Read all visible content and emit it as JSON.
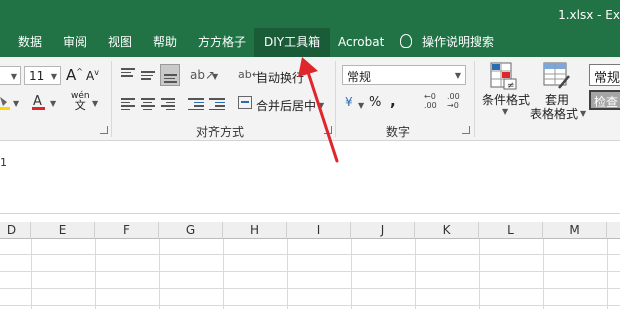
{
  "window": {
    "title": "1.xlsx  -  Ex"
  },
  "tabs": [
    {
      "label": "数据"
    },
    {
      "label": "审阅"
    },
    {
      "label": "视图"
    },
    {
      "label": "帮助"
    },
    {
      "label": "方方格子"
    },
    {
      "label": "DIY工具箱"
    },
    {
      "label": "Acrobat"
    }
  ],
  "active_tab": "DIY工具箱",
  "tell_me": {
    "label": "操作说明搜索"
  },
  "font": {
    "size": "11"
  },
  "alignment": {
    "wrap_text": "自动换行",
    "merge_center": "合并后居中",
    "group_label": "对齐方式"
  },
  "number": {
    "format": "常规",
    "currency_symbol": "¥",
    "percent": "%",
    "comma": ",",
    "group_label": "数字"
  },
  "styles": {
    "conditional_format": "条件格式",
    "table_format_line1": "套用",
    "table_format_line2": "表格格式",
    "style_normal": "常规",
    "style_check": "检查"
  },
  "formula_bar": {
    "value": "1"
  },
  "columns": [
    "D",
    "E",
    "F",
    "G",
    "H",
    "I",
    "J",
    "K",
    "L",
    "M"
  ],
  "colors": {
    "ribbon_green": "#217346",
    "arrow_red": "#e0262d"
  }
}
